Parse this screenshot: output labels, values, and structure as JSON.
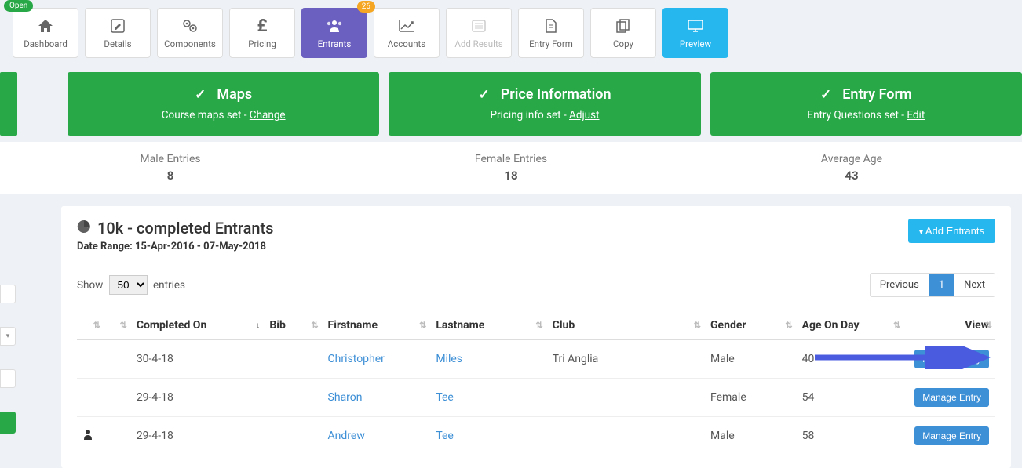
{
  "nav": {
    "open_badge": "Open",
    "items": [
      {
        "label": "Dashboard",
        "icon": "home"
      },
      {
        "label": "Details",
        "icon": "edit"
      },
      {
        "label": "Components",
        "icon": "cogs"
      },
      {
        "label": "Pricing",
        "icon": "pound"
      },
      {
        "label": "Entrants",
        "icon": "users",
        "active": true,
        "count": "26"
      },
      {
        "label": "Accounts",
        "icon": "chart"
      },
      {
        "label": "Add Results",
        "icon": "addresults",
        "disabled": true
      },
      {
        "label": "Entry Form",
        "icon": "form"
      },
      {
        "label": "Copy",
        "icon": "copy"
      },
      {
        "label": "Preview",
        "icon": "monitor",
        "primary": true
      }
    ]
  },
  "cards": [
    {
      "title": "Maps",
      "subtext": "Course maps set - ",
      "link": "Change"
    },
    {
      "title": "Price Information",
      "subtext": "Pricing info set - ",
      "link": "Adjust"
    },
    {
      "title": "Entry Form",
      "subtext": "Entry Questions set - ",
      "link": "Edit"
    }
  ],
  "stats": [
    {
      "label": "Male Entries",
      "value": "8"
    },
    {
      "label": "Female Entries",
      "value": "18"
    },
    {
      "label": "Average Age",
      "value": "43"
    }
  ],
  "panel": {
    "title": "10k - completed Entrants",
    "date_range_label": "Date Range: 15-Apr-2016 - 07-May-2018",
    "add_btn": "Add Entrants"
  },
  "table": {
    "show_prefix": "Show",
    "show_suffix": "entries",
    "page_size": "50",
    "pager": {
      "prev": "Previous",
      "next": "Next",
      "page": "1"
    },
    "columns": [
      "",
      "",
      "Completed On",
      "Bib",
      "Firstname",
      "Lastname",
      "Club",
      "Gender",
      "Age On Day",
      "View"
    ],
    "rows": [
      {
        "completed": "30-4-18",
        "bib": "",
        "first": "Christopher",
        "last": "Miles",
        "club": "Tri Anglia",
        "gender": "Male",
        "age": "40",
        "icon": false
      },
      {
        "completed": "29-4-18",
        "bib": "",
        "first": "Sharon",
        "last": "Tee",
        "club": "",
        "gender": "Female",
        "age": "54",
        "icon": false
      },
      {
        "completed": "29-4-18",
        "bib": "",
        "first": "Andrew",
        "last": "Tee",
        "club": "",
        "gender": "Male",
        "age": "58",
        "icon": true
      }
    ],
    "manage": "Manage Entry"
  }
}
